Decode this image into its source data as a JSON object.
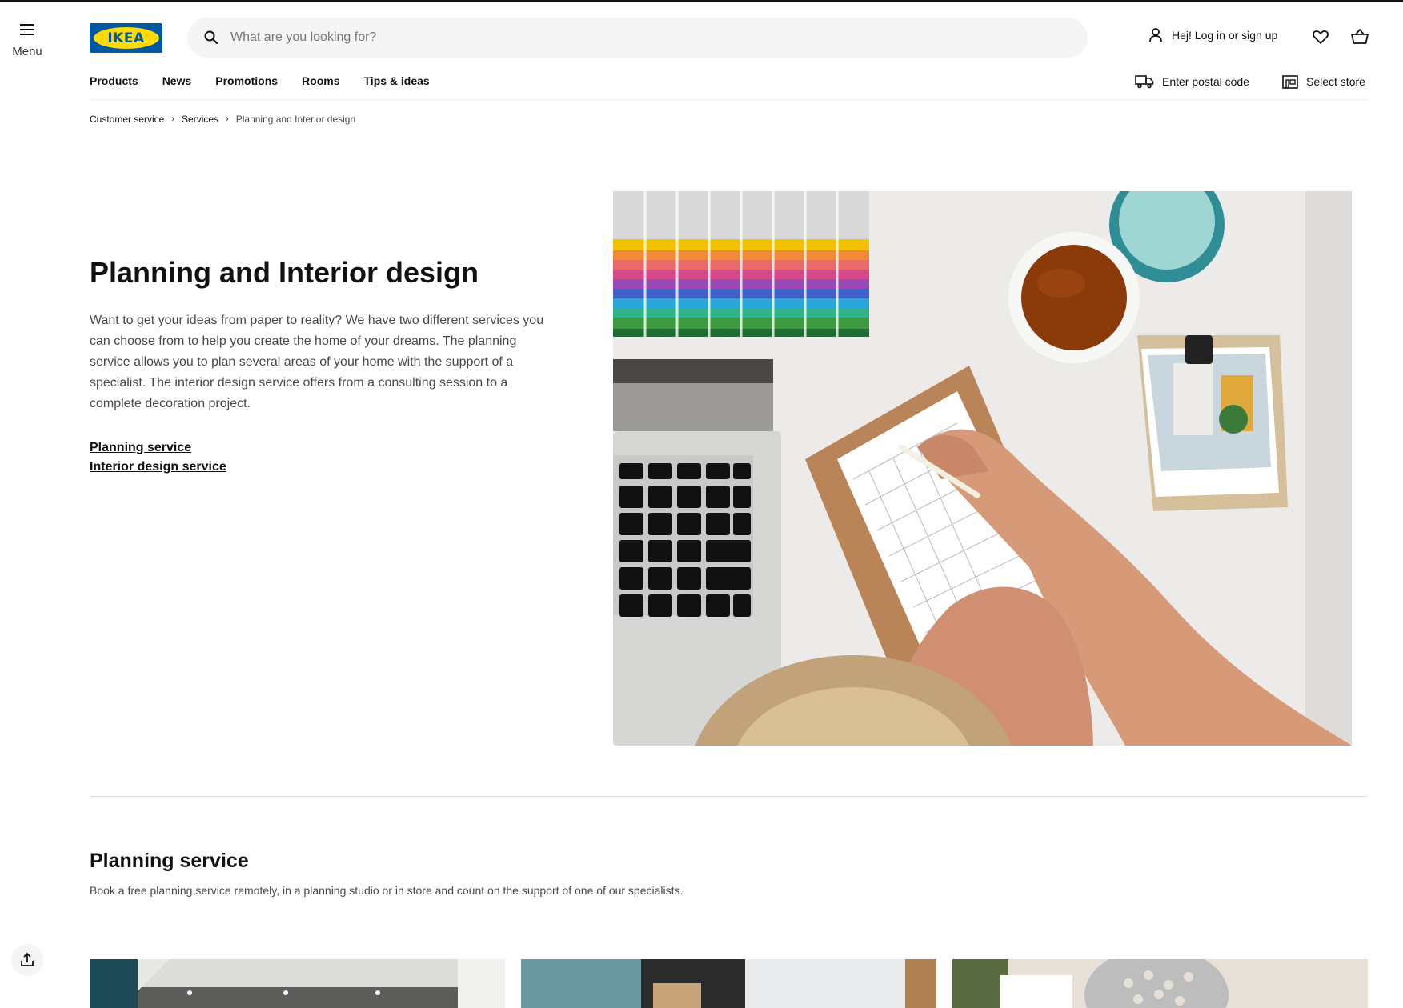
{
  "header": {
    "menu_label": "Menu",
    "logo_text": "IKEA",
    "search_placeholder": "What are you looking for?",
    "login_label": "Hej! Log in or sign up",
    "icons": {
      "menu": "hamburger-icon",
      "search": "search-icon",
      "user": "user-icon",
      "favourites": "heart-icon",
      "cart": "shopping-bag-icon",
      "delivery": "truck-icon",
      "store": "store-icon",
      "share": "share-icon"
    },
    "colors": {
      "brand_blue": "#0058a3",
      "brand_yellow": "#ffdb00"
    }
  },
  "nav": {
    "items": [
      {
        "label": "Products"
      },
      {
        "label": "News"
      },
      {
        "label": "Promotions"
      },
      {
        "label": "Rooms"
      },
      {
        "label": "Tips & ideas"
      }
    ],
    "postal_label": "Enter postal code",
    "store_label": "Select store"
  },
  "breadcrumb": {
    "items": [
      "Customer service",
      "Services",
      "Planning and Interior design"
    ],
    "separator": "›"
  },
  "hero": {
    "title": "Planning and Interior design",
    "text": "Want to get your ideas from paper to reality? We have two different services you can choose from to help you create the home of your dreams. The planning service allows you to plan several areas of your home with the support of a specialist. The interior design service offers from a consulting session to a complete decoration project.",
    "links": [
      {
        "label": "Planning service"
      },
      {
        "label": "Interior design service"
      }
    ],
    "image_logo_text": "IKEA"
  },
  "planning_section": {
    "title": "Planning service",
    "text": "Book a free planning service remotely, in a planning studio or in store and count on the support of one of our specialists."
  }
}
